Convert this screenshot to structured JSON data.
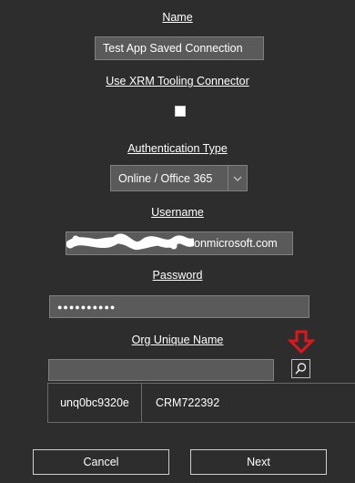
{
  "form": {
    "name_label": "Name",
    "name_value": "Test App Saved Connection",
    "xrm_label": "Use XRM Tooling Connector",
    "auth_label": "Authentication Type",
    "auth_value": "Online / Office 365",
    "username_label": "Username",
    "username_visible_suffix": "onmicrosoft.com",
    "password_label": "Password",
    "password_masked": "●●●●●●●●●●",
    "org_label": "Org Unique Name",
    "org_value": ""
  },
  "org_results": [
    {
      "unique_name": "unq0bc9320e",
      "friendly_name": "CRM722392"
    }
  ],
  "buttons": {
    "cancel": "Cancel",
    "next": "Next"
  },
  "icons": {
    "search": "magnifier-icon",
    "annotation": "red-down-arrow-icon",
    "dropdown": "chevron-down-icon"
  },
  "colors": {
    "background": "#2d2d2d",
    "field": "#5a5a5a",
    "annotation": "#e0161c"
  }
}
